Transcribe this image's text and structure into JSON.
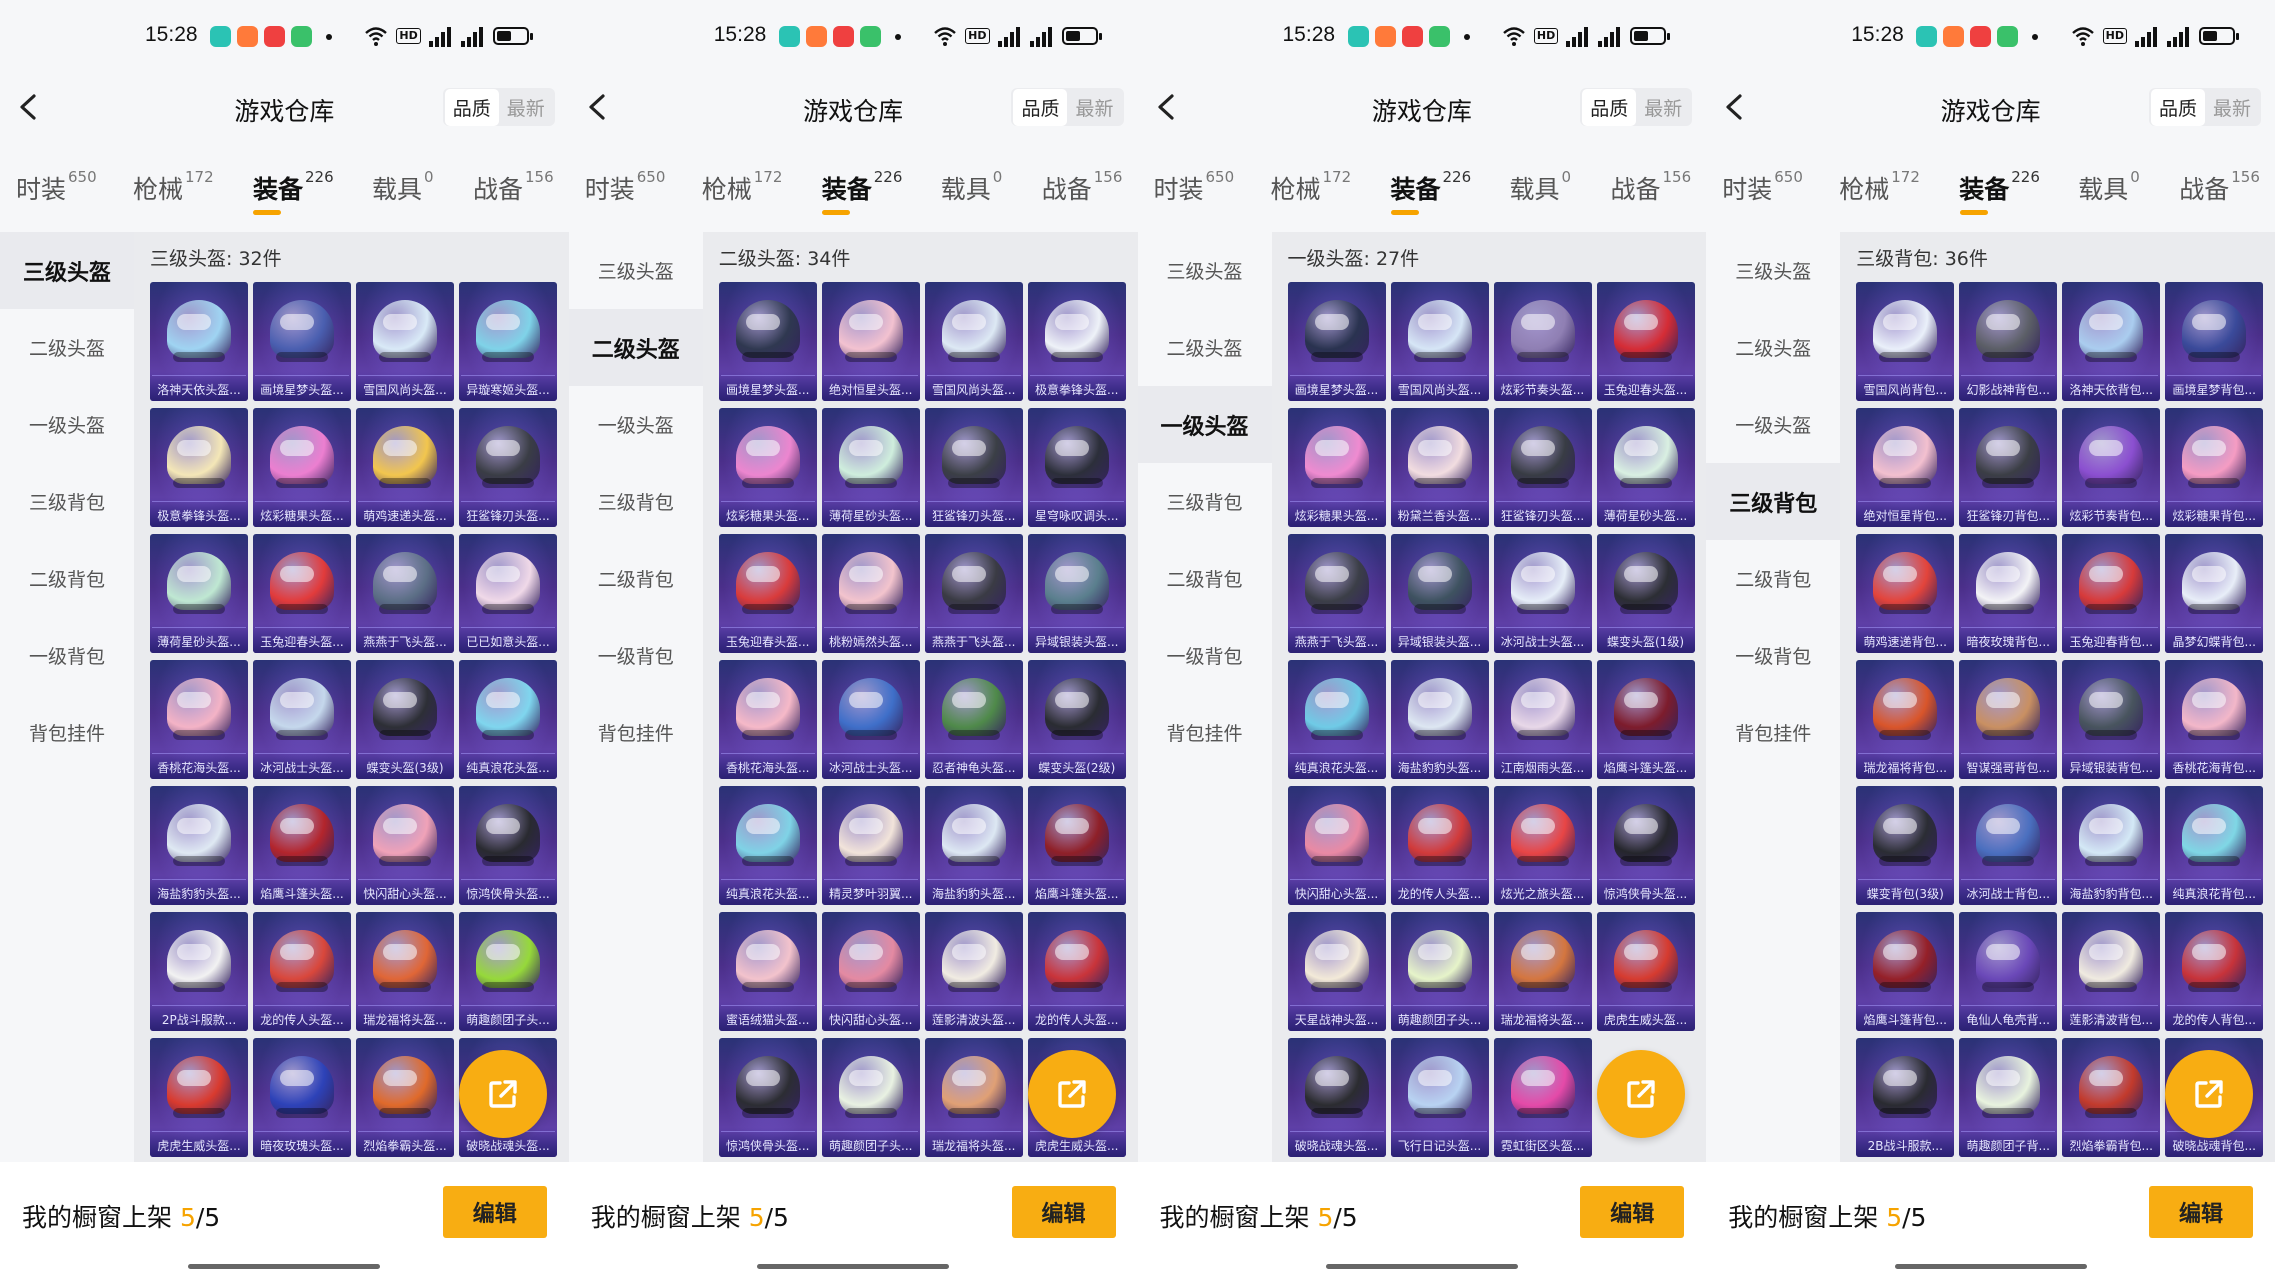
{
  "time": "15:28",
  "title": "游戏仓库",
  "sort": [
    "品质",
    "最新"
  ],
  "tabs": [
    {
      "label": "时装",
      "count": "650"
    },
    {
      "label": "枪械",
      "count": "172"
    },
    {
      "label": "装备",
      "count": "226"
    },
    {
      "label": "载具",
      "count": "0"
    },
    {
      "label": "战备",
      "count": "156"
    }
  ],
  "active_tab": 2,
  "sidebar": [
    "三级头盔",
    "二级头盔",
    "一级头盔",
    "三级背包",
    "二级背包",
    "一级背包",
    "背包挂件"
  ],
  "footer": {
    "label": "我的橱窗上架",
    "current": "5",
    "total": "/5",
    "edit": "编辑"
  },
  "icons": [
    "back-arrow-icon",
    "wifi-icon",
    "signal-icon",
    "battery-icon",
    "share-icon"
  ],
  "colors": {
    "accent": "#f8ad12"
  },
  "screens": [
    {
      "selected_side": 0,
      "heading": "三级头盔: 32件",
      "items": [
        {
          "name": "洛神天依头盔...",
          "c": "#9fd4f2"
        },
        {
          "name": "画境星梦头盔...",
          "c": "#4a5fb0"
        },
        {
          "name": "雪国风尚头盔...",
          "c": "#d9eaf7"
        },
        {
          "name": "异璇寒姬头盔...",
          "c": "#7fd3e8"
        },
        {
          "name": "极意拳锋头盔...",
          "c": "#f4e7b7"
        },
        {
          "name": "炫彩糖果头盔...",
          "c": "#ec7fd0"
        },
        {
          "name": "萌鸡速递头盔...",
          "c": "#f2c64e"
        },
        {
          "name": "狂鲨锋刃头盔...",
          "c": "#3a3d45"
        },
        {
          "name": "薄荷星砂头盔...",
          "c": "#bfe8d2"
        },
        {
          "name": "玉兔迎春头盔...",
          "c": "#e23b3b"
        },
        {
          "name": "燕燕于飞头盔...",
          "c": "#5c6f86"
        },
        {
          "name": "已已如意头盔...",
          "c": "#f0d9e8"
        },
        {
          "name": "香桃花海头盔...",
          "c": "#f4b3c6"
        },
        {
          "name": "冰河战士头盔...",
          "c": "#c5d8ec"
        },
        {
          "name": "蝶变头盔(3级)",
          "c": "#2d2f36"
        },
        {
          "name": "纯真浪花头盔...",
          "c": "#7fd6ee"
        },
        {
          "name": "海盐豹豹头盔...",
          "c": "#dfe9f3"
        },
        {
          "name": "焰鹰斗篷头盔...",
          "c": "#b3252c"
        },
        {
          "name": "快闪甜心头盔...",
          "c": "#f0a2b8"
        },
        {
          "name": "惊鸿侠骨头盔...",
          "c": "#292a30"
        },
        {
          "name": "2P战斗服款...",
          "c": "#f2f2f2"
        },
        {
          "name": "龙的传人头盔...",
          "c": "#d9473b"
        },
        {
          "name": "瑞龙福将头盔...",
          "c": "#e06636"
        },
        {
          "name": "萌趣颜团子头...",
          "c": "#96d93a"
        },
        {
          "name": "虎虎生威头盔...",
          "c": "#d93a2e"
        },
        {
          "name": "暗夜玫瑰头盔...",
          "c": "#2d42b8"
        },
        {
          "name": "烈焰拳霸头盔...",
          "c": "#e06a2a"
        },
        {
          "name": "破晓战魂头盔...",
          "c": "#444a55"
        }
      ]
    },
    {
      "selected_side": 1,
      "heading": "二级头盔: 34件",
      "items": [
        {
          "name": "画境星梦头盔...",
          "c": "#2f3850"
        },
        {
          "name": "绝对恒星头盔...",
          "c": "#f3c2d0"
        },
        {
          "name": "雪国风尚头盔...",
          "c": "#dde9f4"
        },
        {
          "name": "极意拳锋头盔...",
          "c": "#eef2f8"
        },
        {
          "name": "炫彩糖果头盔...",
          "c": "#ec86cf"
        },
        {
          "name": "薄荷星砂头盔...",
          "c": "#cfeedd"
        },
        {
          "name": "狂鲨锋刃头盔...",
          "c": "#3b3f46"
        },
        {
          "name": "星穹咏叹调头...",
          "c": "#2c2f3a"
        },
        {
          "name": "玉兔迎春头盔...",
          "c": "#d93b3b"
        },
        {
          "name": "桃粉嫣然头盔...",
          "c": "#f3c4cd"
        },
        {
          "name": "燕燕于飞头盔...",
          "c": "#3a3b44"
        },
        {
          "name": "异域银装头盔...",
          "c": "#5a7f8d"
        },
        {
          "name": "香桃花海头盔...",
          "c": "#f6b9c8"
        },
        {
          "name": "冰河战士头盔...",
          "c": "#3f6fc9"
        },
        {
          "name": "忍者神龟头盔...",
          "c": "#4f8a4a"
        },
        {
          "name": "蝶变头盔(2级)",
          "c": "#2a2c32"
        },
        {
          "name": "纯真浪花头盔...",
          "c": "#7fd3e6"
        },
        {
          "name": "精灵梦叶羽翼...",
          "c": "#f2e4da"
        },
        {
          "name": "海盐豹豹头盔...",
          "c": "#dde8f3"
        },
        {
          "name": "焰鹰斗篷头盔...",
          "c": "#8f2028"
        },
        {
          "name": "蜜语绒猫头盔...",
          "c": "#f3c3cc"
        },
        {
          "name": "快闪甜心头盔...",
          "c": "#e48aa2"
        },
        {
          "name": "莲影清波头盔...",
          "c": "#f1ece2"
        },
        {
          "name": "龙的传人头盔...",
          "c": "#c9343a"
        },
        {
          "name": "惊鸿侠骨头盔...",
          "c": "#2c2d33"
        },
        {
          "name": "萌趣颜团子头...",
          "c": "#e9f2e2"
        },
        {
          "name": "瑞龙福将头盔...",
          "c": "#e0a075"
        },
        {
          "name": "虎虎生威头盔...",
          "c": "#c93a30"
        }
      ]
    },
    {
      "selected_side": 2,
      "heading": "一级头盔: 27件",
      "items": [
        {
          "name": "画境星梦头盔...",
          "c": "#2a3350"
        },
        {
          "name": "雪国风尚头盔...",
          "c": "#d6e6f6"
        },
        {
          "name": "炫彩节奏头盔...",
          "c": "#8f7fb3"
        },
        {
          "name": "玉兔迎春头盔...",
          "c": "#d52c35"
        },
        {
          "name": "炫彩糖果头盔...",
          "c": "#ef8bd0"
        },
        {
          "name": "粉黛兰香头盔...",
          "c": "#f2dde0"
        },
        {
          "name": "狂鲨锋刃头盔...",
          "c": "#383c44"
        },
        {
          "name": "薄荷星砂头盔...",
          "c": "#d9f0e2"
        },
        {
          "name": "燕燕于飞头盔...",
          "c": "#3b3e47"
        },
        {
          "name": "异域银装头盔...",
          "c": "#3e5260"
        },
        {
          "name": "冰河战士头盔...",
          "c": "#e6eef8"
        },
        {
          "name": "蝶变头盔(1级)",
          "c": "#2c2e34"
        },
        {
          "name": "纯真浪花头盔...",
          "c": "#6fcbe6"
        },
        {
          "name": "海盐豹豹头盔...",
          "c": "#dde7f2"
        },
        {
          "name": "江南烟雨头盔...",
          "c": "#e8d8e8"
        },
        {
          "name": "焰鹰斗篷头盔...",
          "c": "#7d1c2c"
        },
        {
          "name": "快闪甜心头盔...",
          "c": "#e98aa4"
        },
        {
          "name": "龙的传人头盔...",
          "c": "#d13a3a"
        },
        {
          "name": "炫光之旅头盔...",
          "c": "#e84545"
        },
        {
          "name": "惊鸿侠骨头盔...",
          "c": "#25262c"
        },
        {
          "name": "天星战神头盔...",
          "c": "#f3ead8"
        },
        {
          "name": "萌趣颜团子头...",
          "c": "#e6f4c9"
        },
        {
          "name": "瑞龙福将头盔...",
          "c": "#d4763f"
        },
        {
          "name": "虎虎生威头盔...",
          "c": "#d63b2f"
        },
        {
          "name": "破晓战魂头盔...",
          "c": "#2b2c30"
        },
        {
          "name": "飞行日记头盔...",
          "c": "#b8d3f2"
        },
        {
          "name": "霓虹街区头盔...",
          "c": "#e44aa8"
        }
      ]
    },
    {
      "selected_side": 3,
      "heading": "三级背包: 36件",
      "items": [
        {
          "name": "雪国风尚背包...",
          "c": "#eaf0fa"
        },
        {
          "name": "幻影战神背包...",
          "c": "#5b5e66"
        },
        {
          "name": "洛神天依背包...",
          "c": "#aacdef"
        },
        {
          "name": "画境星梦背包...",
          "c": "#3a4a9a"
        },
        {
          "name": "绝对恒星背包...",
          "c": "#f3c0cf"
        },
        {
          "name": "狂鲨锋刃背包...",
          "c": "#3b3e45"
        },
        {
          "name": "炫彩节奏背包...",
          "c": "#8b4fd0"
        },
        {
          "name": "炫彩糖果背包...",
          "c": "#f59cc3"
        },
        {
          "name": "萌鸡速递背包...",
          "c": "#e3443b"
        },
        {
          "name": "暗夜玫瑰背包...",
          "c": "#f3f3f6"
        },
        {
          "name": "玉兔迎春背包...",
          "c": "#d73a3a"
        },
        {
          "name": "晶梦幻蝶背包...",
          "c": "#e8eef8"
        },
        {
          "name": "瑞龙福将背包...",
          "c": "#d9552a"
        },
        {
          "name": "智谋强哥背包...",
          "c": "#c99062"
        },
        {
          "name": "异域银装背包...",
          "c": "#48545e"
        },
        {
          "name": "香桃花海背包...",
          "c": "#f3b7c9"
        },
        {
          "name": "蝶变背包(3级)",
          "c": "#2b2d34"
        },
        {
          "name": "冰河战士背包...",
          "c": "#4a6fbf"
        },
        {
          "name": "海盐豹豹背包...",
          "c": "#d4e9f6"
        },
        {
          "name": "纯真浪花背包...",
          "c": "#7fd7e5"
        },
        {
          "name": "焰鹰斗篷背包...",
          "c": "#952028"
        },
        {
          "name": "龟仙人龟壳背...",
          "c": "#6a48b8"
        },
        {
          "name": "莲影清波背包...",
          "c": "#f0ebe0"
        },
        {
          "name": "龙的传人背包...",
          "c": "#c7333a"
        },
        {
          "name": "2B战斗服款...",
          "c": "#2a2b31"
        },
        {
          "name": "萌趣颜团子背...",
          "c": "#e8f3de"
        },
        {
          "name": "烈焰拳霸背包...",
          "c": "#c23a2c"
        },
        {
          "name": "破晓战魂背包...",
          "c": "#3a3d45"
        }
      ]
    }
  ]
}
